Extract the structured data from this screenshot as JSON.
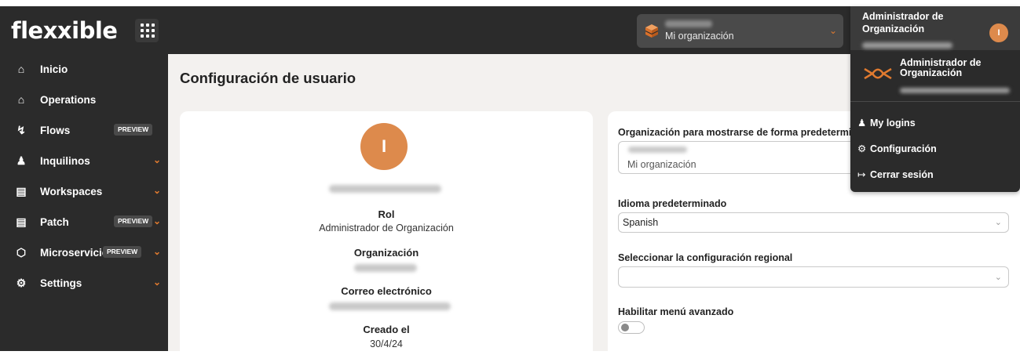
{
  "brand": {
    "logo_text": "flexxible",
    "accent": "#e07a2f",
    "avatar_color": "#dd8a4c"
  },
  "header": {
    "apps_icon": "grid-icon",
    "org_selector": {
      "value": "Mi organización",
      "icon": "cube-stack-icon"
    }
  },
  "sidebar": {
    "items": [
      {
        "label": "Inicio",
        "icon": "home-icon",
        "badge": "",
        "has_chevron": false
      },
      {
        "label": "Operations",
        "icon": "home-icon",
        "badge": "",
        "has_chevron": false
      },
      {
        "label": "Flows",
        "icon": "flow-icon",
        "badge": "PREVIEW",
        "has_chevron": false
      },
      {
        "label": "Inquilinos",
        "icon": "users-icon",
        "badge": "",
        "has_chevron": true
      },
      {
        "label": "Workspaces",
        "icon": "monitor-icon",
        "badge": "",
        "has_chevron": true
      },
      {
        "label": "Patch",
        "icon": "clipboard-icon",
        "badge": "PREVIEW",
        "has_chevron": true
      },
      {
        "label": "Microservicios",
        "icon": "cube-icon",
        "badge": "PREVIEW",
        "has_chevron": true
      },
      {
        "label": "Settings",
        "icon": "gear-icon",
        "badge": "",
        "has_chevron": true
      }
    ]
  },
  "main": {
    "title": "Configuración de usuario",
    "profile": {
      "avatar_initial": "I",
      "role_label": "Rol",
      "role_value": "Administrador de Organización",
      "org_label": "Organización",
      "email_label": "Correo electrónico",
      "created_label": "Creado el",
      "created_value": "30/4/24"
    },
    "settings": {
      "default_org_label": "Organización para mostrarse de forma predetermina",
      "default_org_value": "Mi organización",
      "language_label": "Idioma predeterminado",
      "language_value": "Spanish",
      "regional_label": "Seleccionar la configuración regional",
      "regional_value": "",
      "advanced_menu_label": "Habilitar menú avanzado",
      "advanced_menu_enabled": false
    }
  },
  "user_menu": {
    "role": "Administrador de Organización",
    "avatar_initial": "I",
    "org_role": "Administrador de Organización",
    "items": [
      {
        "label": "My logins",
        "icon": "user-icon"
      },
      {
        "label": "Configuración",
        "icon": "gear-icon"
      },
      {
        "label": "Cerrar sesión",
        "icon": "logout-icon"
      }
    ]
  }
}
